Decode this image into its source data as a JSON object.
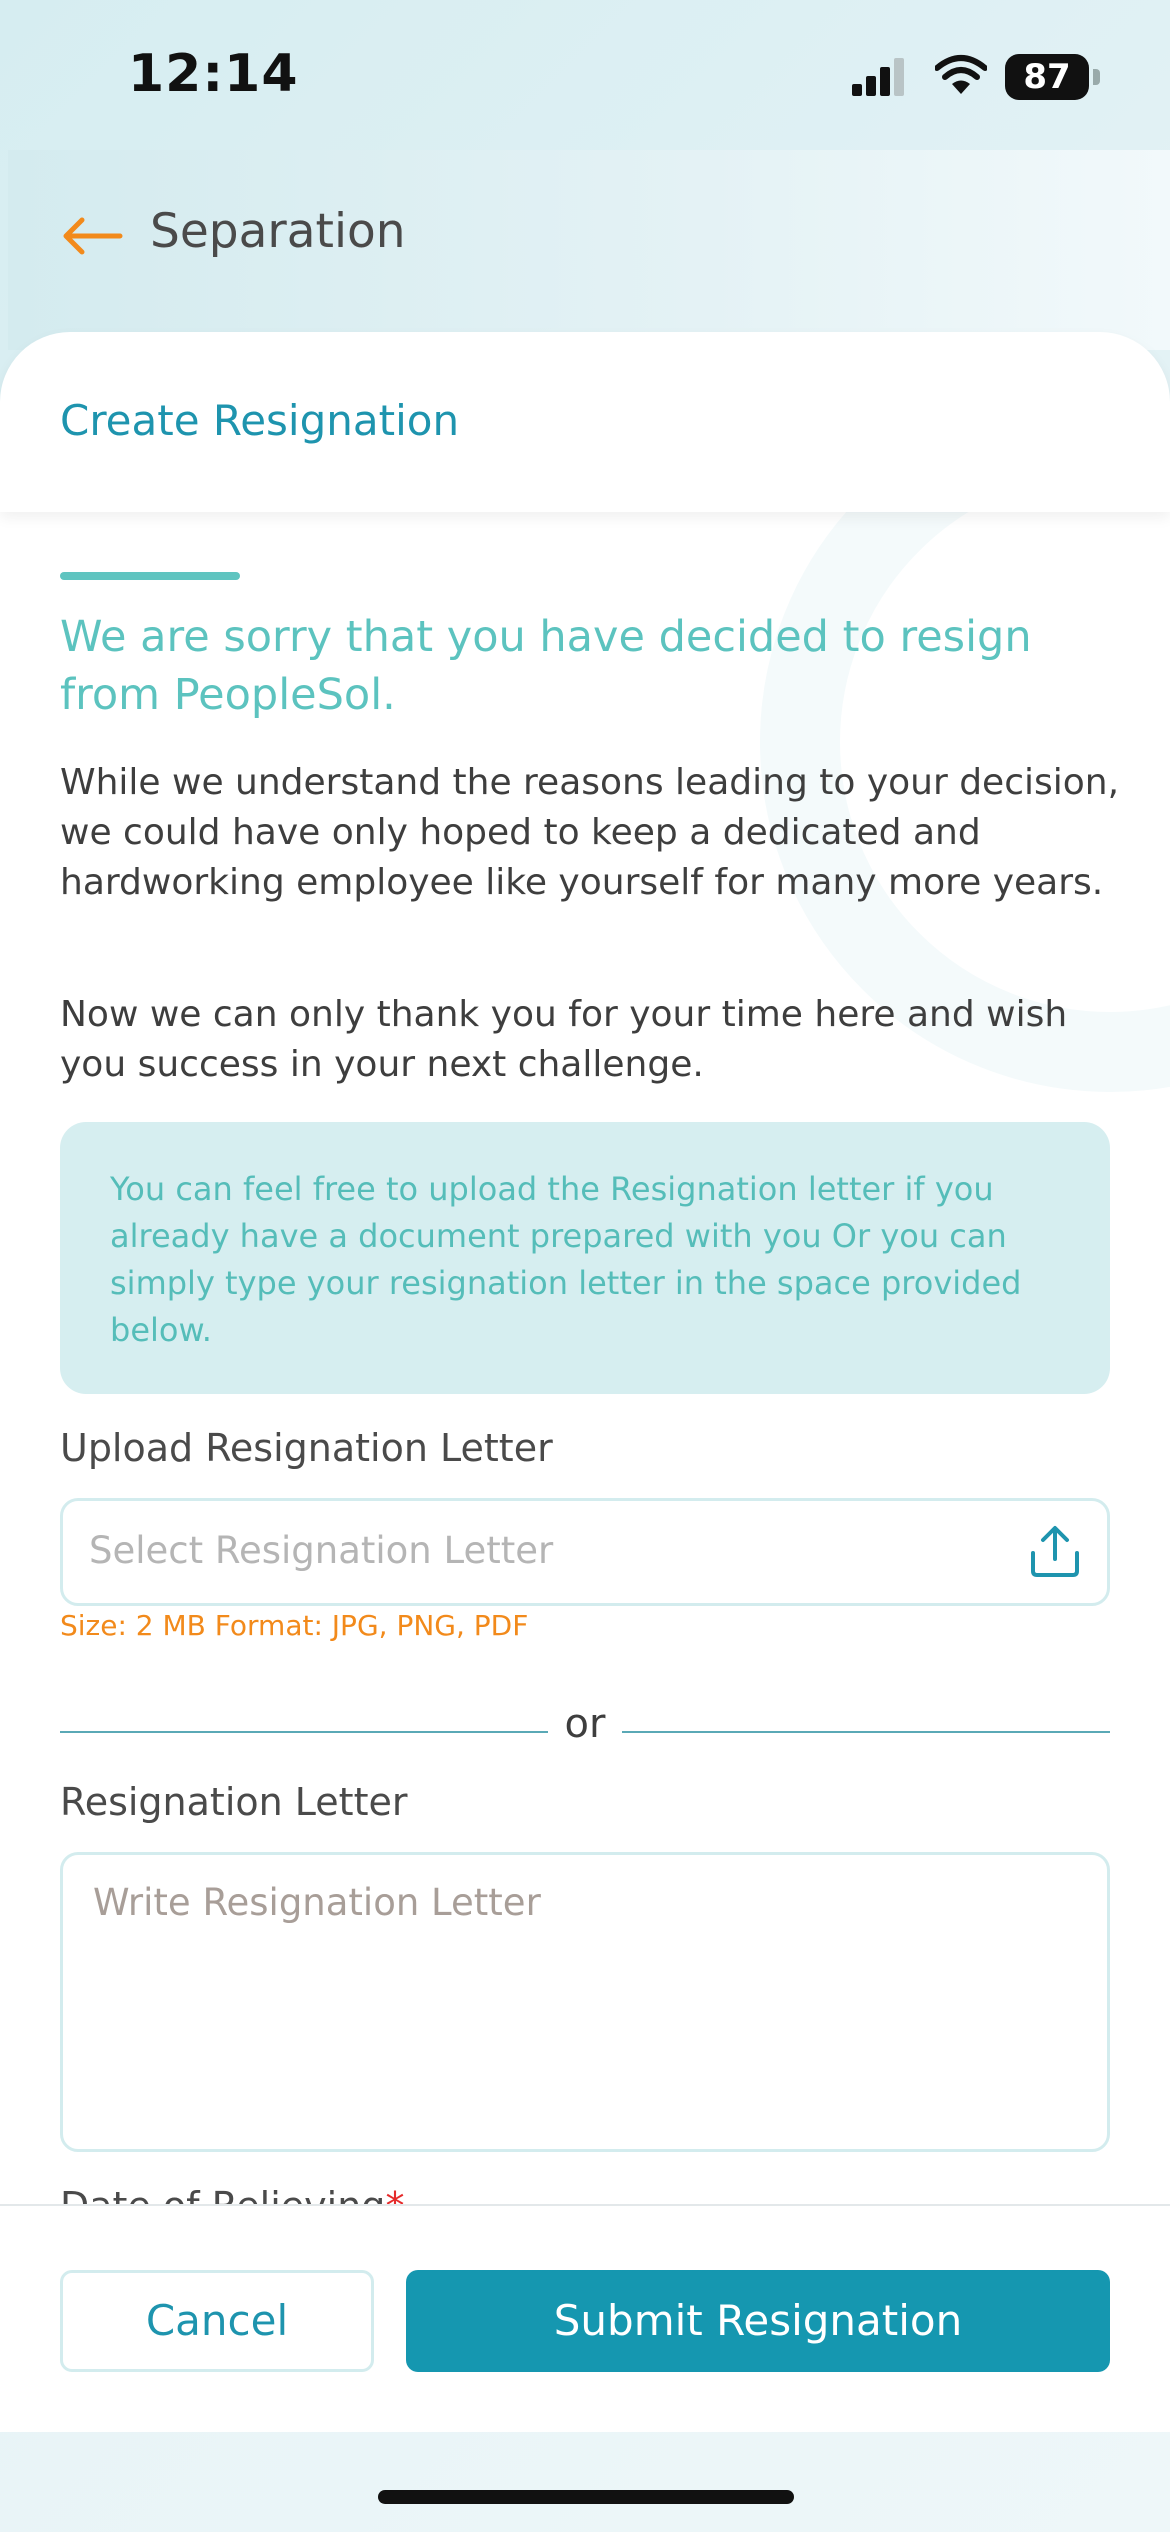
{
  "status_bar": {
    "time": "12:14",
    "battery": "87",
    "icons": [
      "signal-icon",
      "wifi-icon",
      "battery-icon"
    ]
  },
  "header": {
    "title": "Separation",
    "back_icon": "arrow-left-icon",
    "back_icon_color": "#f28a1b"
  },
  "card": {
    "title": "Create Resignation"
  },
  "message": {
    "heading": "We are sorry that you have decided to resign from PeopleSol.",
    "paragraph1": "While we understand the reasons leading to your decision, we could have only hoped to keep a dedicated and hardworking employee like yourself for many more years.",
    "paragraph2": "Now we can only thank you for your time here and wish you success in your next challenge."
  },
  "info": {
    "text": "You can feel free to upload the Resignation letter if you already have a document prepared with you Or you can simply type your resignation letter in the space provided below."
  },
  "upload": {
    "label": "Upload Resignation Letter",
    "placeholder": "Select Resignation Letter",
    "icon": "upload-icon",
    "note": "Size: 2 MB Format: JPG, PNG, PDF"
  },
  "divider": {
    "text": "or"
  },
  "letter": {
    "label": "Resignation Letter",
    "placeholder": "Write Resignation Letter"
  },
  "date": {
    "label": "Date of Relieving",
    "required_mark": "*"
  },
  "footer": {
    "cancel_label": "Cancel",
    "submit_label": "Submit Resignation"
  },
  "colors": {
    "accent": "#1597b0",
    "heading_teal": "#5cc3bf",
    "warning_orange": "#f28a1b",
    "info_bg": "#d6eef0"
  }
}
